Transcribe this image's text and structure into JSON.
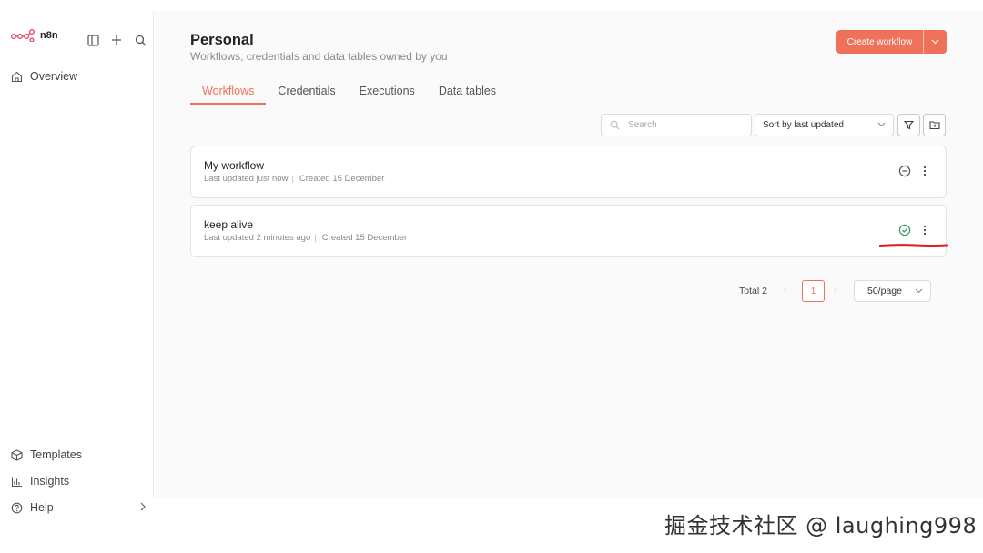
{
  "app": {
    "name": "n8n",
    "brand_color": "#f0715a"
  },
  "sidebar": {
    "items": [
      {
        "label": "Overview",
        "icon": "home-icon"
      },
      {
        "label": "Templates",
        "icon": "box-icon"
      },
      {
        "label": "Insights",
        "icon": "bar-chart-icon"
      },
      {
        "label": "Help",
        "icon": "help-circle-icon"
      }
    ],
    "tools": [
      "panel-toggle-icon",
      "plus-icon",
      "search-icon"
    ]
  },
  "header": {
    "title": "Personal",
    "subtitle": "Workflows, credentials and data tables owned by you",
    "create_label": "Create workflow"
  },
  "tabs": [
    {
      "label": "Workflows",
      "active": true
    },
    {
      "label": "Credentials",
      "active": false
    },
    {
      "label": "Executions",
      "active": false
    },
    {
      "label": "Data tables",
      "active": false
    }
  ],
  "toolbar": {
    "search_placeholder": "Search",
    "sort_value": "Sort by last updated"
  },
  "workflows": [
    {
      "name": "My workflow",
      "updated": "Last updated just now",
      "created": "Created 15 December",
      "status": "inactive",
      "status_icon": "minus-circle-icon"
    },
    {
      "name": "keep alive",
      "updated": "Last updated 2 minutes ago",
      "created": "Created 15 December",
      "status": "active",
      "status_icon": "check-circle-icon",
      "status_color": "#2e9b5f"
    }
  ],
  "pagination": {
    "total": "Total 2",
    "current_page": "1",
    "per_page": "50/page"
  },
  "watermark": "掘金技术社区 @ laughing998"
}
